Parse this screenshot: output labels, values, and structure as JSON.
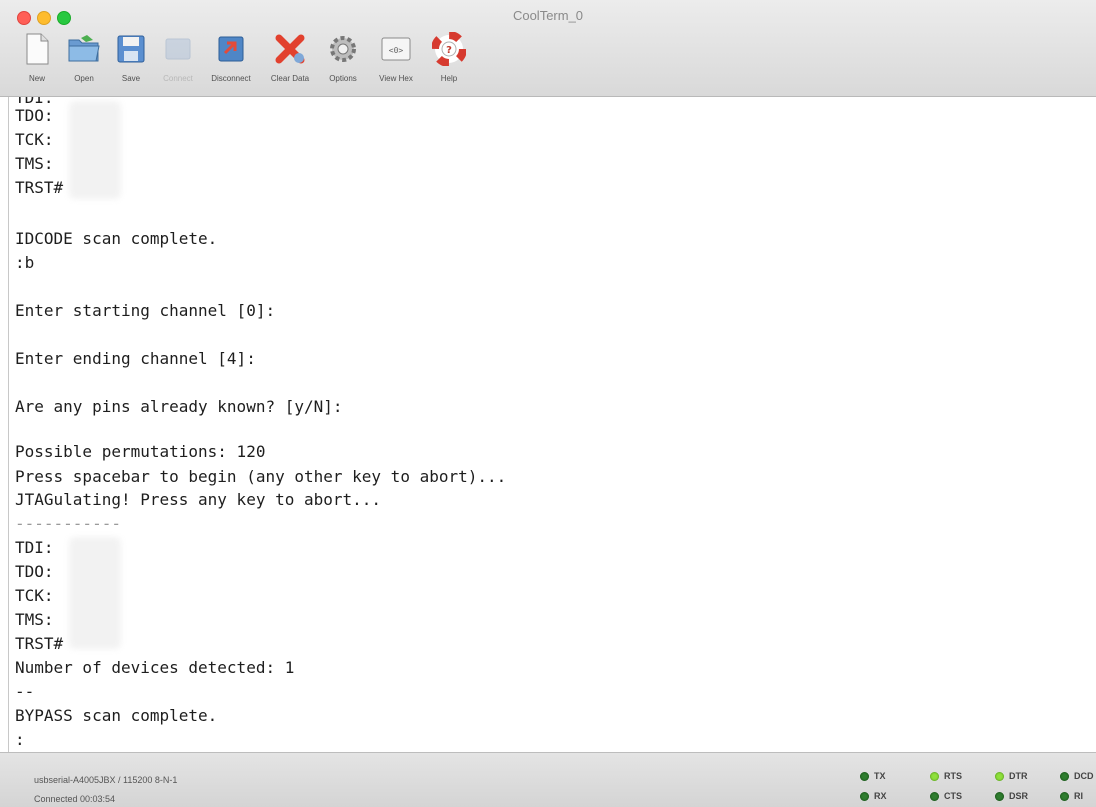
{
  "window": {
    "title": "CoolTerm_0"
  },
  "toolbar": {
    "new": "New",
    "open": "Open",
    "save": "Save",
    "connect": "Connect",
    "disconnect": "Disconnect",
    "clear_data": "Clear Data",
    "options": "Options",
    "view_hex": "View Hex",
    "help": "Help"
  },
  "terminal": {
    "lines": [
      "TDI:",
      "TDO:",
      "TCK:",
      "TMS:",
      "TRST#",
      "",
      "IDCODE scan complete.",
      ":b",
      "",
      "Enter starting channel [0]:",
      "",
      "Enter ending channel [4]:",
      "",
      "Are any pins already known? [y/N]:",
      "",
      "Possible permutations: 120",
      "Press spacebar to begin (any other key to abort)...",
      "JTAGulating! Press any key to abort...",
      "-----------",
      "TDI:",
      "TDO:",
      "TCK:",
      "TMS:",
      "TRST#",
      "Number of devices detected: 1",
      "--",
      "BYPASS scan complete.",
      ":"
    ]
  },
  "status": {
    "port": "usbserial-A4005JBX / 115200 8-N-1",
    "connection": "Connected 00:03:54",
    "leds": {
      "tx": "TX",
      "rx": "RX",
      "rts": "RTS",
      "cts": "CTS",
      "dtr": "DTR",
      "dsr": "DSR",
      "dcd": "DCD",
      "ri": "RI"
    }
  }
}
